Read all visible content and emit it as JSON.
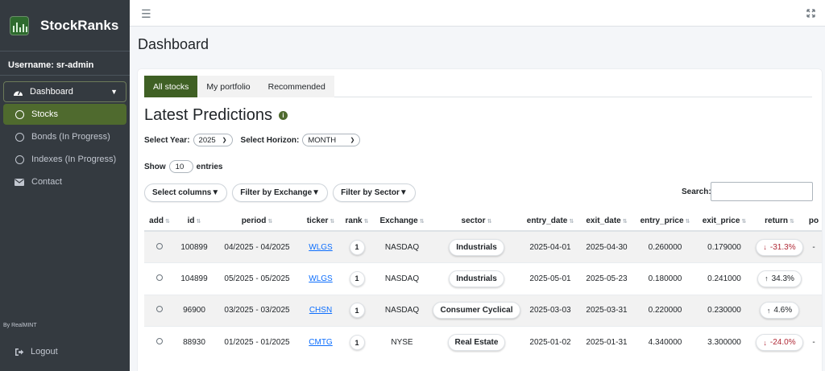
{
  "app": {
    "name": "StockRanks",
    "byline": "By RealMINT"
  },
  "user": {
    "label": "Username: sr-admin"
  },
  "sidebar": {
    "parent": {
      "label": "Dashboard"
    },
    "items": [
      {
        "label": "Stocks",
        "icon": "circle-icon",
        "active": true
      },
      {
        "label": "Bonds (In Progress)",
        "icon": "circle-icon"
      },
      {
        "label": "Indexes (In Progress)",
        "icon": "circle-icon"
      },
      {
        "label": "Contact",
        "icon": "envelope-icon"
      }
    ],
    "logout": "Logout"
  },
  "header": {
    "title": "Dashboard"
  },
  "tabs": [
    {
      "label": "All stocks",
      "active": true
    },
    {
      "label": "My portfolio"
    },
    {
      "label": "Recommended"
    }
  ],
  "main": {
    "title": "Latest Predictions",
    "year_label": "Select Year:",
    "year_value": "2025",
    "horizon_label": "Select Horizon:",
    "horizon_value": "MONTH",
    "show_label": "Show",
    "show_value": "10",
    "entries_label": "entries",
    "buttons": {
      "columns": "Select columns▼",
      "exchange": "Filter by Exchange▼",
      "sector": "Filter by Sector▼"
    },
    "search_label": "Search:"
  },
  "table": {
    "columns": [
      "add",
      "id",
      "period",
      "ticker",
      "rank",
      "Exchange",
      "sector",
      "entry_date",
      "exit_date",
      "entry_price",
      "exit_price",
      "return",
      "po"
    ],
    "rows": [
      {
        "id": "100899",
        "period": "04/2025 - 04/2025",
        "ticker": "WLGS",
        "rank": "1",
        "exchange": "NASDAQ",
        "sector": "Industrials",
        "entry_date": "2025-04-01",
        "exit_date": "2025-04-30",
        "entry_price": "0.260000",
        "exit_price": "0.179000",
        "return": "-31.3%",
        "trend": "down",
        "po": "-"
      },
      {
        "id": "104899",
        "period": "05/2025 - 05/2025",
        "ticker": "WLGS",
        "rank": "1",
        "exchange": "NASDAQ",
        "sector": "Industrials",
        "entry_date": "2025-05-01",
        "exit_date": "2025-05-23",
        "entry_price": "0.180000",
        "exit_price": "0.241000",
        "return": "34.3%",
        "trend": "up",
        "po": ""
      },
      {
        "id": "96900",
        "period": "03/2025 - 03/2025",
        "ticker": "CHSN",
        "rank": "1",
        "exchange": "NASDAQ",
        "sector": "Consumer Cyclical",
        "entry_date": "2025-03-03",
        "exit_date": "2025-03-31",
        "entry_price": "0.220000",
        "exit_price": "0.230000",
        "return": "4.6%",
        "trend": "up",
        "po": ""
      },
      {
        "id": "88930",
        "period": "01/2025 - 01/2025",
        "ticker": "CMTG",
        "rank": "1",
        "exchange": "NYSE",
        "sector": "Real Estate",
        "entry_date": "2025-01-02",
        "exit_date": "2025-01-31",
        "entry_price": "4.340000",
        "exit_price": "3.300000",
        "return": "-24.0%",
        "trend": "down",
        "po": "-"
      }
    ]
  },
  "colors": {
    "sidebar_bg": "#343a40",
    "accent": "#4f6a2e",
    "tab_active": "#3f6024",
    "negative": "#b02a37",
    "link": "#0d6efd"
  }
}
